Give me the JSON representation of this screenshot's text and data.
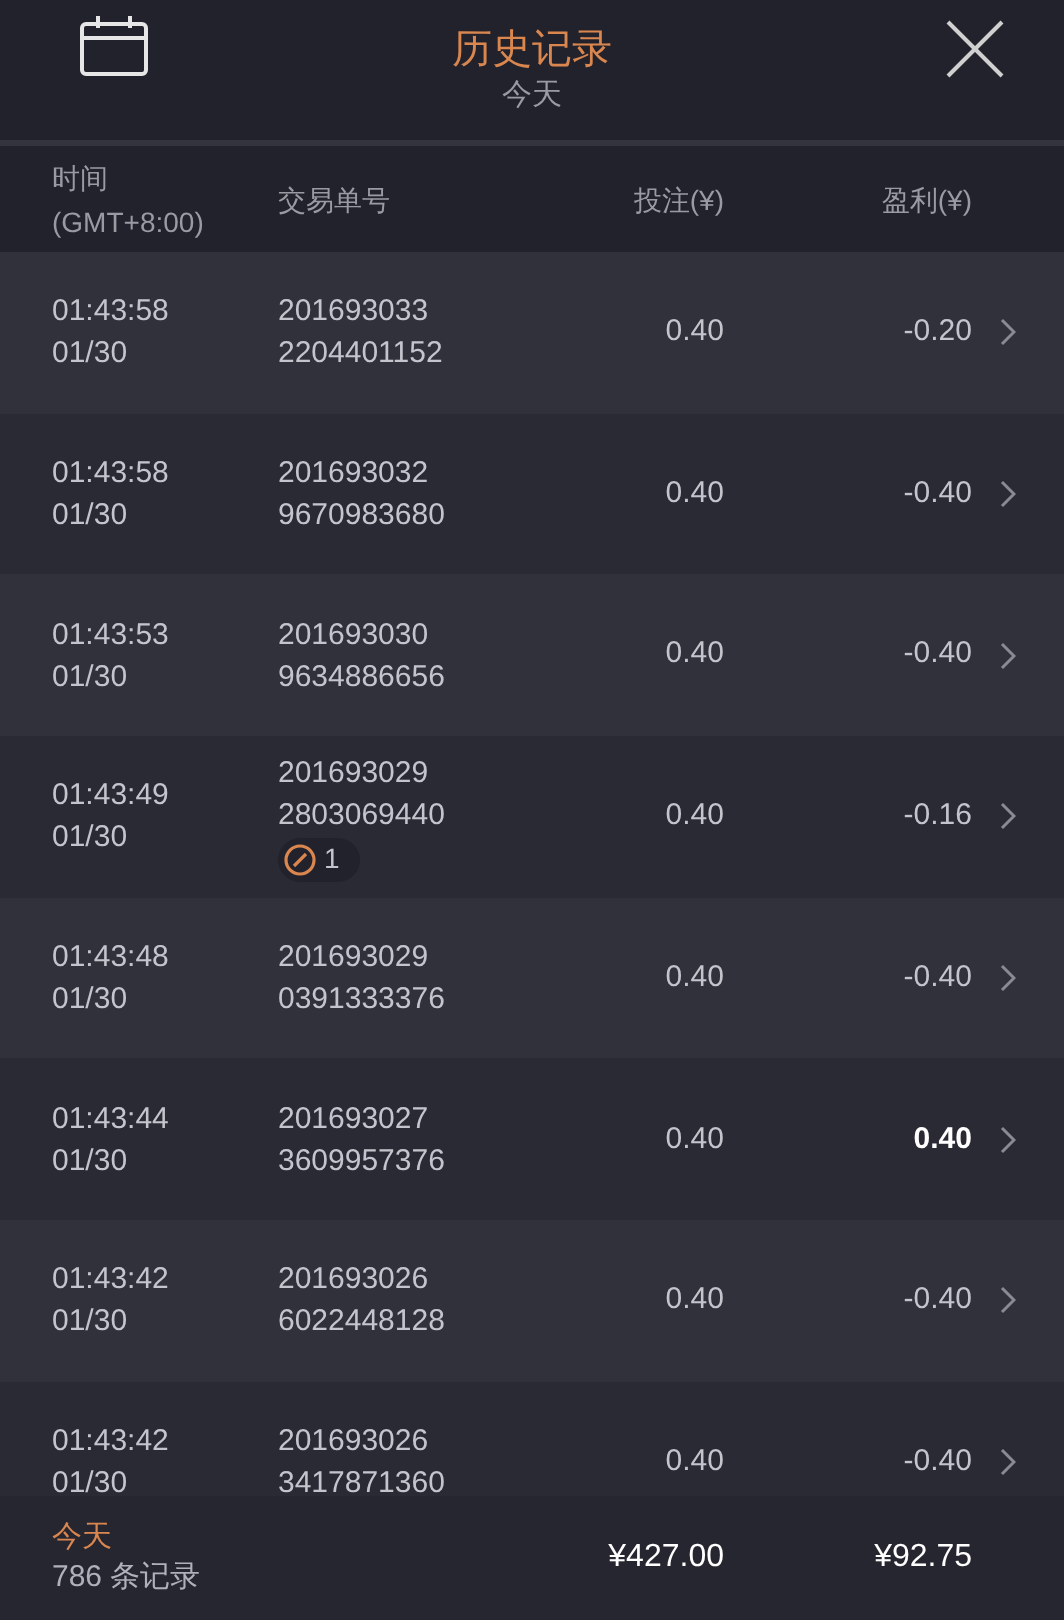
{
  "header": {
    "title": "历史记录",
    "subtitle": "今天"
  },
  "columns": [
    {
      "line1": "时间",
      "line2": "(GMT+8:00)"
    },
    {
      "line1": "交易单号"
    },
    {
      "line1": "投注(¥)"
    },
    {
      "line1": "盈利(¥)"
    }
  ],
  "rows": [
    {
      "time": "01:43:58",
      "date": "01/30",
      "order_1": "201693033",
      "order_2": "2204401152",
      "stake": "0.40",
      "profit": "-0.20",
      "win": false
    },
    {
      "time": "01:43:58",
      "date": "01/30",
      "order_1": "201693032",
      "order_2": "9670983680",
      "stake": "0.40",
      "profit": "-0.40",
      "win": false
    },
    {
      "time": "01:43:53",
      "date": "01/30",
      "order_1": "201693030",
      "order_2": "9634886656",
      "stake": "0.40",
      "profit": "-0.40",
      "win": false
    },
    {
      "time": "01:43:49",
      "date": "01/30",
      "order_1": "201693029",
      "order_2": "2803069440",
      "badge": "1",
      "stake": "0.40",
      "profit": "-0.16",
      "win": false
    },
    {
      "time": "01:43:48",
      "date": "01/30",
      "order_1": "201693029",
      "order_2": "0391333376",
      "stake": "0.40",
      "profit": "-0.40",
      "win": false
    },
    {
      "time": "01:43:44",
      "date": "01/30",
      "order_1": "201693027",
      "order_2": "3609957376",
      "stake": "0.40",
      "profit": "0.40",
      "win": true
    },
    {
      "time": "01:43:42",
      "date": "01/30",
      "order_1": "201693026",
      "order_2": "6022448128",
      "stake": "0.40",
      "profit": "-0.40",
      "win": false
    },
    {
      "time": "01:43:42",
      "date": "01/30",
      "order_1": "201693026",
      "order_2": "3417871360",
      "stake": "0.40",
      "profit": "-0.40",
      "win": false
    }
  ],
  "footer": {
    "period": "今天",
    "count": "786 条记录",
    "total_stake": "¥427.00",
    "total_profit": "¥92.75"
  }
}
